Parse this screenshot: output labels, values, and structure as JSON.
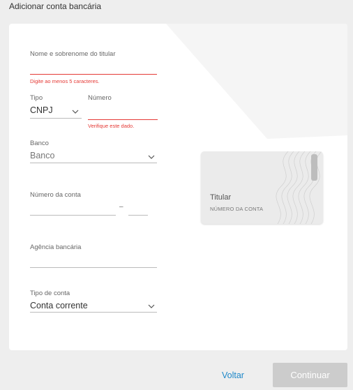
{
  "page": {
    "title": "Adicionar conta bancária"
  },
  "form": {
    "holder_name": {
      "label": "Nome e sobrenome do titular",
      "value": "",
      "error": "Digite ao menos 5 caracteres."
    },
    "doc_type": {
      "label": "Tipo",
      "value": "CNPJ"
    },
    "doc_number": {
      "label": "Número",
      "value": "",
      "error": "Verifique este dado."
    },
    "bank": {
      "label": "Banco",
      "value": "Banco"
    },
    "account_number": {
      "label": "Número da conta",
      "separator": "–",
      "value": "",
      "digit": ""
    },
    "agency": {
      "label": "Agência bancária",
      "value": ""
    },
    "account_type": {
      "label": "Tipo de conta",
      "value": "Conta corrente"
    }
  },
  "preview": {
    "holder": "Titular",
    "account": "NÚMERO DA CONTA"
  },
  "footer": {
    "back_label": "Voltar",
    "continue_label": "Continuar"
  },
  "colors": {
    "error": "#e53935",
    "link": "#1e88c9",
    "button_disabled": "#cccccc"
  }
}
